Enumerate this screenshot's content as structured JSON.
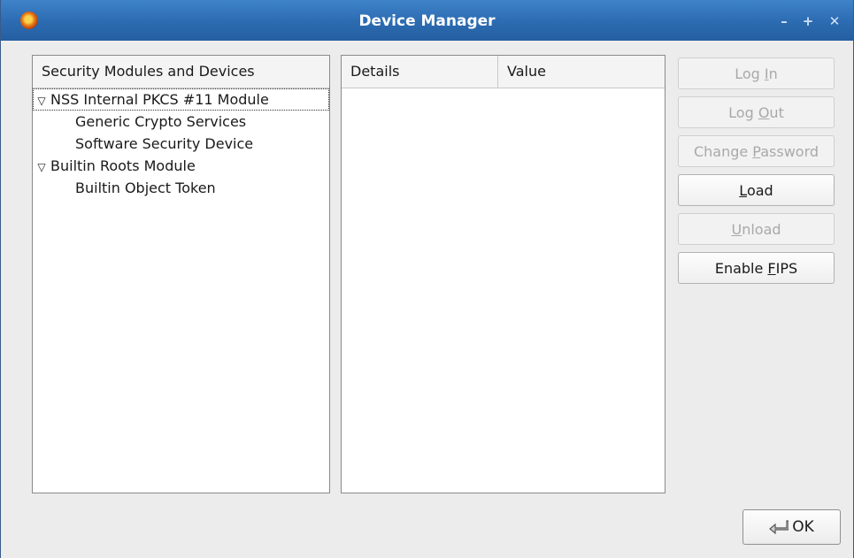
{
  "window": {
    "title": "Device Manager",
    "controls": [
      "minimize",
      "maximize",
      "close"
    ]
  },
  "tree": {
    "header": "Security Modules and Devices",
    "items": [
      {
        "label": "NSS Internal PKCS #11 Module",
        "expanded": true,
        "level": 0
      },
      {
        "label": "Generic Crypto Services",
        "level": 1
      },
      {
        "label": "Software Security Device",
        "level": 1
      },
      {
        "label": "Builtin Roots Module",
        "expanded": true,
        "level": 0
      },
      {
        "label": "Builtin Object Token",
        "level": 1
      }
    ]
  },
  "details": {
    "columns": [
      "Details",
      "Value"
    ]
  },
  "buttons": {
    "login": {
      "pre": "Log ",
      "key": "I",
      "post": "n",
      "enabled": false
    },
    "logout": {
      "pre": "Log ",
      "key": "O",
      "post": "ut",
      "enabled": false
    },
    "change_password": {
      "pre": "Change ",
      "key": "P",
      "post": "assword",
      "enabled": false
    },
    "load": {
      "pre": "",
      "key": "L",
      "post": "oad",
      "enabled": true
    },
    "unload": {
      "pre": "",
      "key": "U",
      "post": "nload",
      "enabled": false
    },
    "enable_fips": {
      "pre": "Enable ",
      "key": "F",
      "post": "IPS",
      "enabled": true
    },
    "ok": {
      "label": "OK"
    }
  }
}
